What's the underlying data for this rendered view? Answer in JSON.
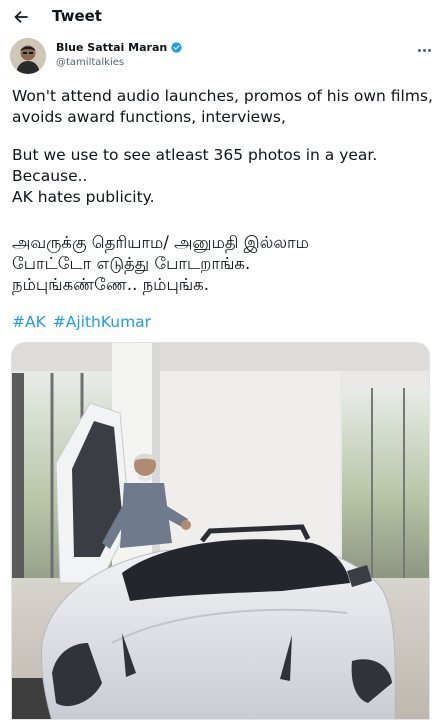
{
  "header": {
    "title": "Tweet",
    "back_icon": "arrow-left-icon"
  },
  "author": {
    "display_name": "Blue Sattai Maran",
    "handle": "@tamiltalkies",
    "verified": true
  },
  "tweet": {
    "lines": [
      "Won't attend audio launches, promos of his own films,",
      "avoids award functions, interviews,",
      "But we use to see atleast 365 photos in a year.",
      "Because..",
      "AK hates publicity."
    ],
    "tamil_lines": [
      "அவருக்கு தெரியாம/  அனுமதி இல்லாம",
      "போட்டோ எடுத்து போடறாங்க.",
      "நம்புங்கண்ணே.. நம்புங்க."
    ],
    "hashtags": [
      "#AK",
      "#AjithKumar"
    ]
  },
  "colors": {
    "link": "#1d9bf0",
    "verified": "#1d9bf0",
    "secondary_text": "#536471"
  }
}
